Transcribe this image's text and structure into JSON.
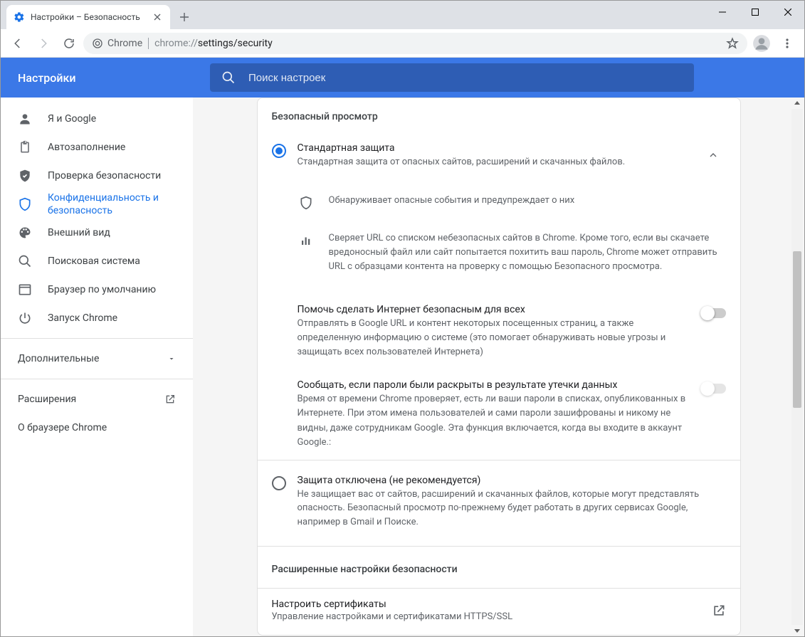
{
  "window": {
    "tab_title": "Настройки – Безопасность"
  },
  "omnibox": {
    "chip": "Chrome",
    "url_prefix": "chrome://",
    "url_path": "settings/security"
  },
  "header": {
    "title": "Настройки",
    "search_placeholder": "Поиск настроек"
  },
  "sidebar": {
    "items": [
      {
        "label": "Я и Google"
      },
      {
        "label": "Автозаполнение"
      },
      {
        "label": "Проверка безопасности"
      },
      {
        "label": "Конфиденциальность и безопасность"
      },
      {
        "label": "Внешний вид"
      },
      {
        "label": "Поисковая система"
      },
      {
        "label": "Браузер по умолчанию"
      },
      {
        "label": "Запуск Chrome"
      }
    ],
    "advanced": "Дополнительные",
    "extensions": "Расширения",
    "about": "О браузере Chrome"
  },
  "main": {
    "section": "Безопасный просмотр",
    "standard": {
      "title": "Стандартная защита",
      "subtitle": "Стандартная защита от опасных сайтов, расширений и скачанных файлов.",
      "detail1": "Обнаруживает опасные события и предупреждает о них",
      "detail2": "Сверяет URL со списком небезопасных сайтов в Chrome. Кроме того, если вы скачаете вредоносный файл или сайт попытается похитить ваш пароль, Chrome может отправить URL с образцами контента на проверку с помощью Безопасного просмотра."
    },
    "toggle1": {
      "title": "Помочь сделать Интернет безопасным для всех",
      "sub": "Отправлять в Google URL и контент некоторых посещенных страниц, а также определенную информацию о системе (это помогает обнаруживать новые угрозы и защищать всех пользователей Интернета)"
    },
    "toggle2": {
      "title": "Сообщать, если пароли были раскрыты в результате утечки данных",
      "sub": "Время от времени Chrome проверяет, есть ли ваши пароли в списках, опубликованных в Интернете. При этом имена пользователей и сами пароли зашифрованы и никому не видны, даже сотрудникам Google. Эта функция включается, когда вы входите в аккаунт Google.:"
    },
    "noprotect": {
      "title": "Защита отключена (не рекомендуется)",
      "sub": "Не защищает вас от сайтов, расширений и скачанных файлов, которые могут представлять опасность. Безопасный просмотр по-прежнему будет работать в других сервисах Google, например в Gmail и Поиске."
    },
    "advanced_section": "Расширенные настройки безопасности",
    "certs": {
      "title": "Настроить сертификаты",
      "sub": "Управление настройками и сертификатами HTTPS/SSL"
    }
  }
}
